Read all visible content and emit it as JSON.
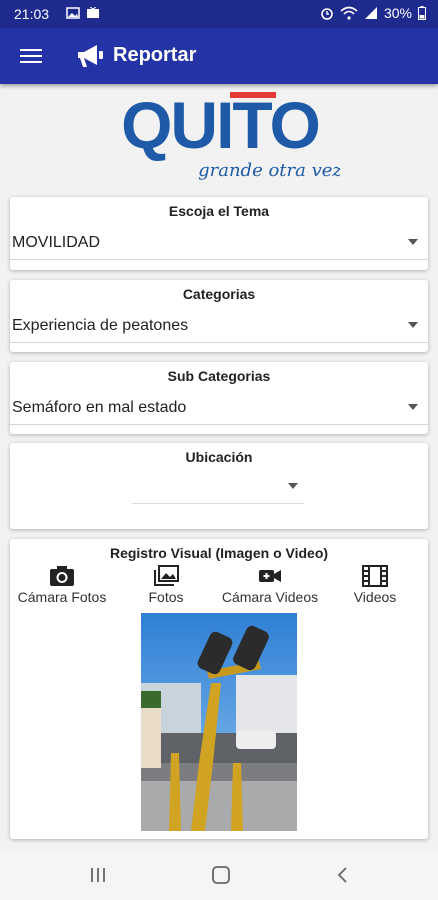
{
  "status_bar": {
    "time": "21:03",
    "battery": "30%"
  },
  "app_bar": {
    "title": "Reportar"
  },
  "logo": {
    "text": "QUITO",
    "tagline": "grande otra vez"
  },
  "tema": {
    "label": "Escoja el Tema",
    "value": "MOVILIDAD"
  },
  "categorias": {
    "label": "Categorias",
    "value": "Experiencia de peatones"
  },
  "subcategorias": {
    "label": "Sub Categorias",
    "value": "Semáforo en mal estado"
  },
  "ubicacion": {
    "label": "Ubicación",
    "value": ""
  },
  "registro": {
    "label": "Registro Visual (Imagen o Video)",
    "buttons": [
      "Cámara Fotos",
      "Fotos",
      "Cámara Videos",
      "Videos"
    ]
  },
  "colors": {
    "primary": "#2433a5",
    "status_bar": "#1f2a8f",
    "logo_blue": "#1e5aa8",
    "logo_red": "#e53935"
  }
}
